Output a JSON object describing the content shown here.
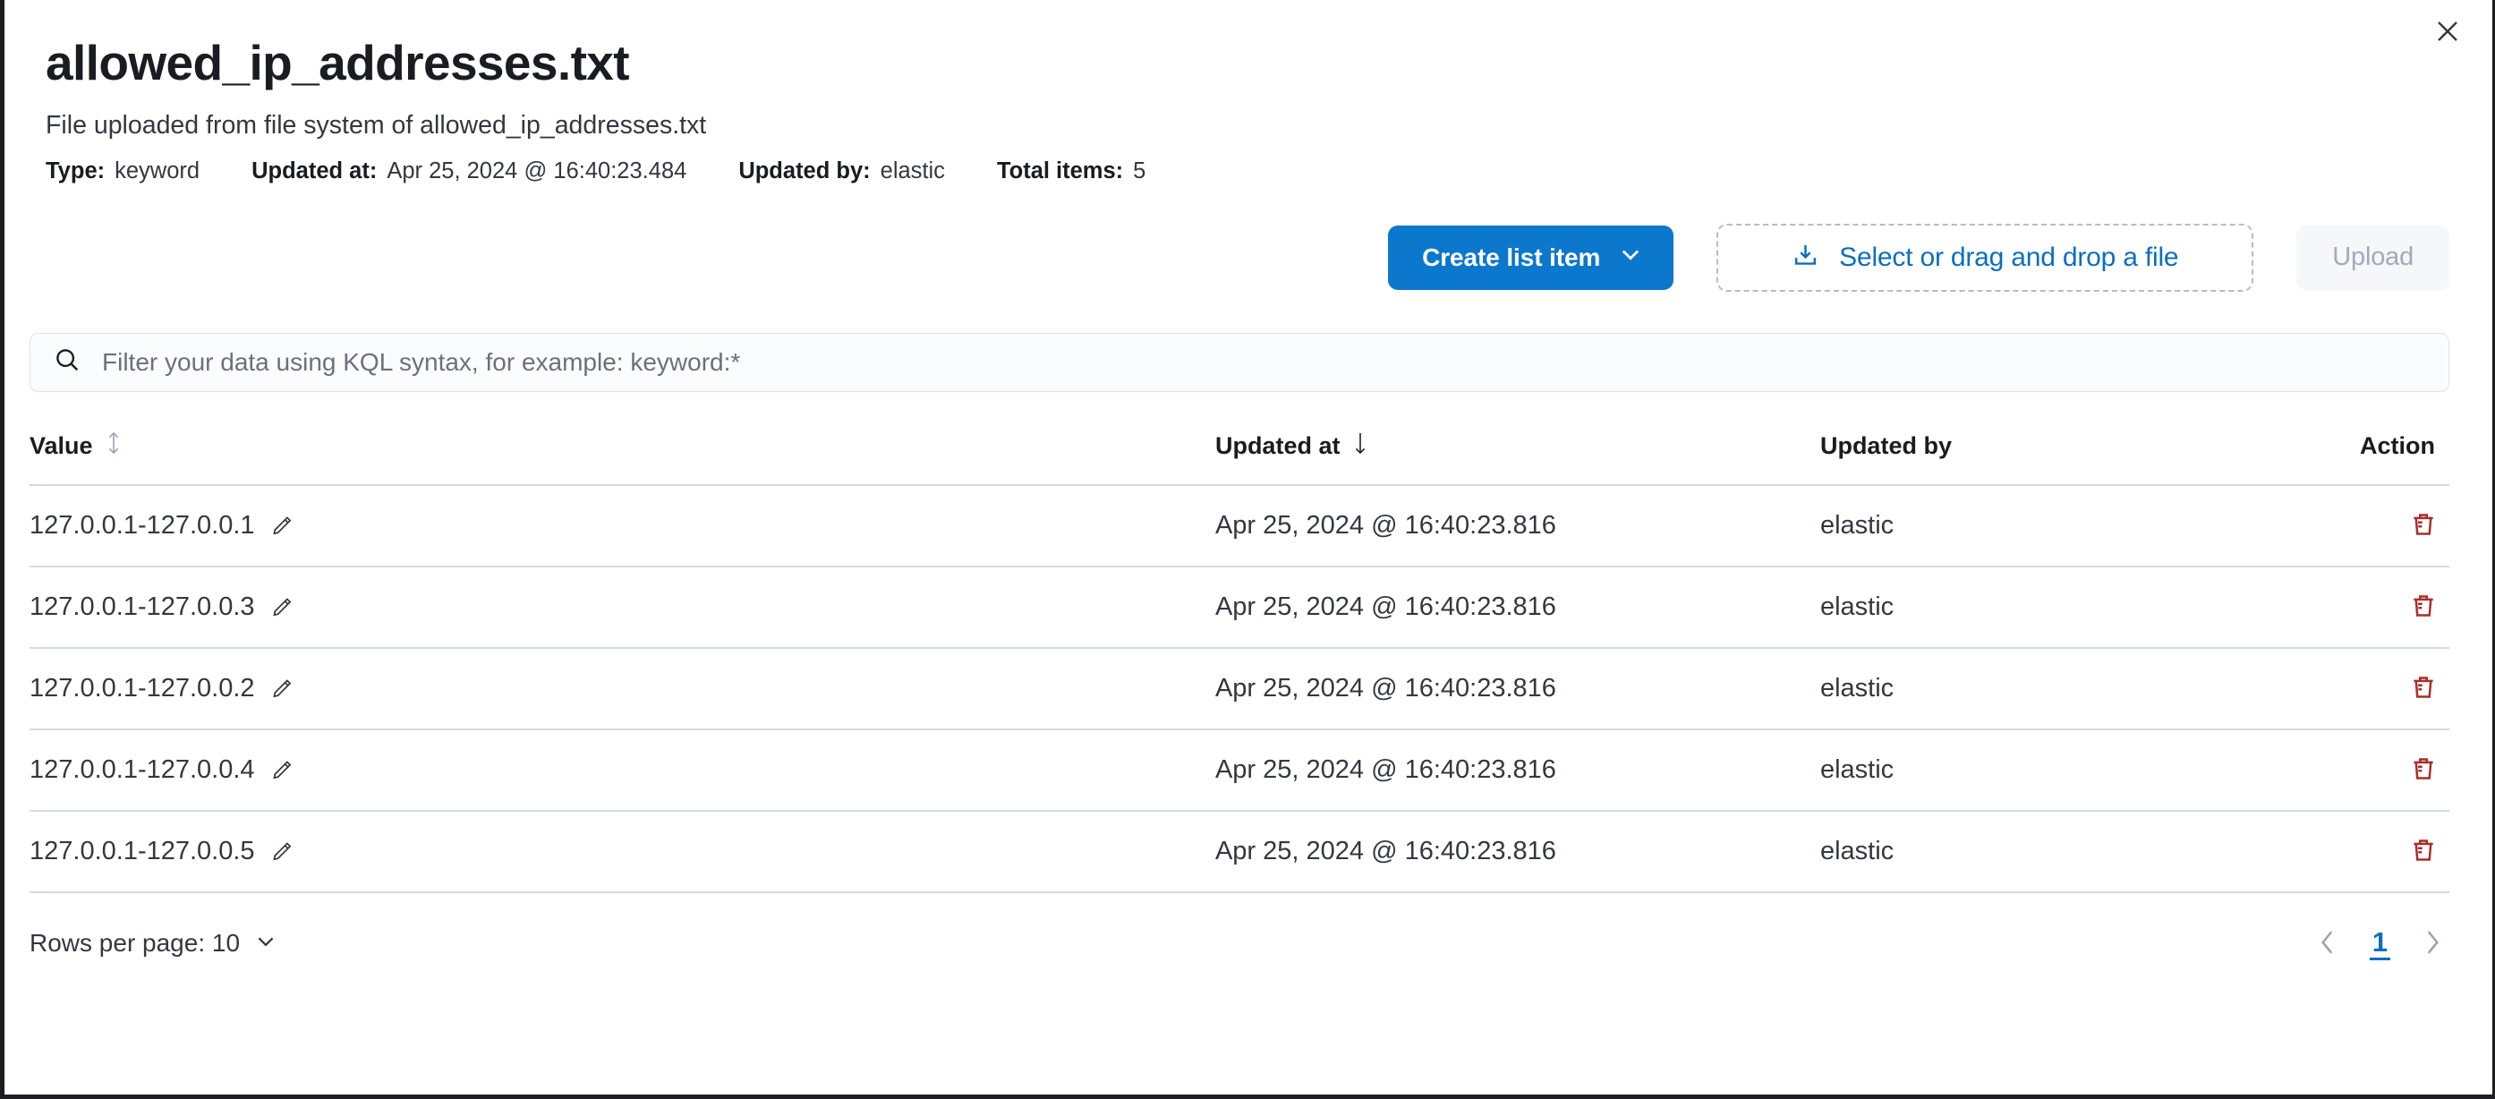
{
  "flyout": {
    "title": "allowed_ip_addresses.txt",
    "subtitle": "File uploaded from file system of allowed_ip_addresses.txt",
    "close_label": "close-icon"
  },
  "meta": [
    {
      "label": "Type:",
      "value": "keyword"
    },
    {
      "label": "Updated at:",
      "value": "Apr 25, 2024 @ 16:40:23.484"
    },
    {
      "label": "Updated by:",
      "value": "elastic"
    },
    {
      "label": "Total items:",
      "value": "5"
    }
  ],
  "actions": {
    "create_label": "Create list item",
    "file_picker_label": "Select or drag and drop a file",
    "upload_label": "Upload"
  },
  "search": {
    "placeholder": "Filter your data using KQL syntax, for example: keyword:*",
    "value": ""
  },
  "table": {
    "headers": {
      "value": "Value",
      "updated_at": "Updated at",
      "updated_by": "Updated by",
      "action": "Action"
    },
    "sort": {
      "value": "sortable",
      "updated_at": "desc"
    },
    "rows": [
      {
        "value": "127.0.0.1-127.0.0.1",
        "updated_at": "Apr 25, 2024 @ 16:40:23.816",
        "updated_by": "elastic"
      },
      {
        "value": "127.0.0.1-127.0.0.3",
        "updated_at": "Apr 25, 2024 @ 16:40:23.816",
        "updated_by": "elastic"
      },
      {
        "value": "127.0.0.1-127.0.0.2",
        "updated_at": "Apr 25, 2024 @ 16:40:23.816",
        "updated_by": "elastic"
      },
      {
        "value": "127.0.0.1-127.0.0.4",
        "updated_at": "Apr 25, 2024 @ 16:40:23.816",
        "updated_by": "elastic"
      },
      {
        "value": "127.0.0.1-127.0.0.5",
        "updated_at": "Apr 25, 2024 @ 16:40:23.816",
        "updated_by": "elastic"
      }
    ]
  },
  "footer": {
    "rows_per_page_label": "Rows per page: 10",
    "current_page": "1"
  },
  "colors": {
    "primary_blue": "#0b77cd",
    "link_blue": "#0b6ec0",
    "danger_red": "#a92e27",
    "border_grey": "#d3dae6",
    "text_dark": "#1a1c21",
    "text_body": "#343741",
    "muted_grey": "#a2abba"
  }
}
